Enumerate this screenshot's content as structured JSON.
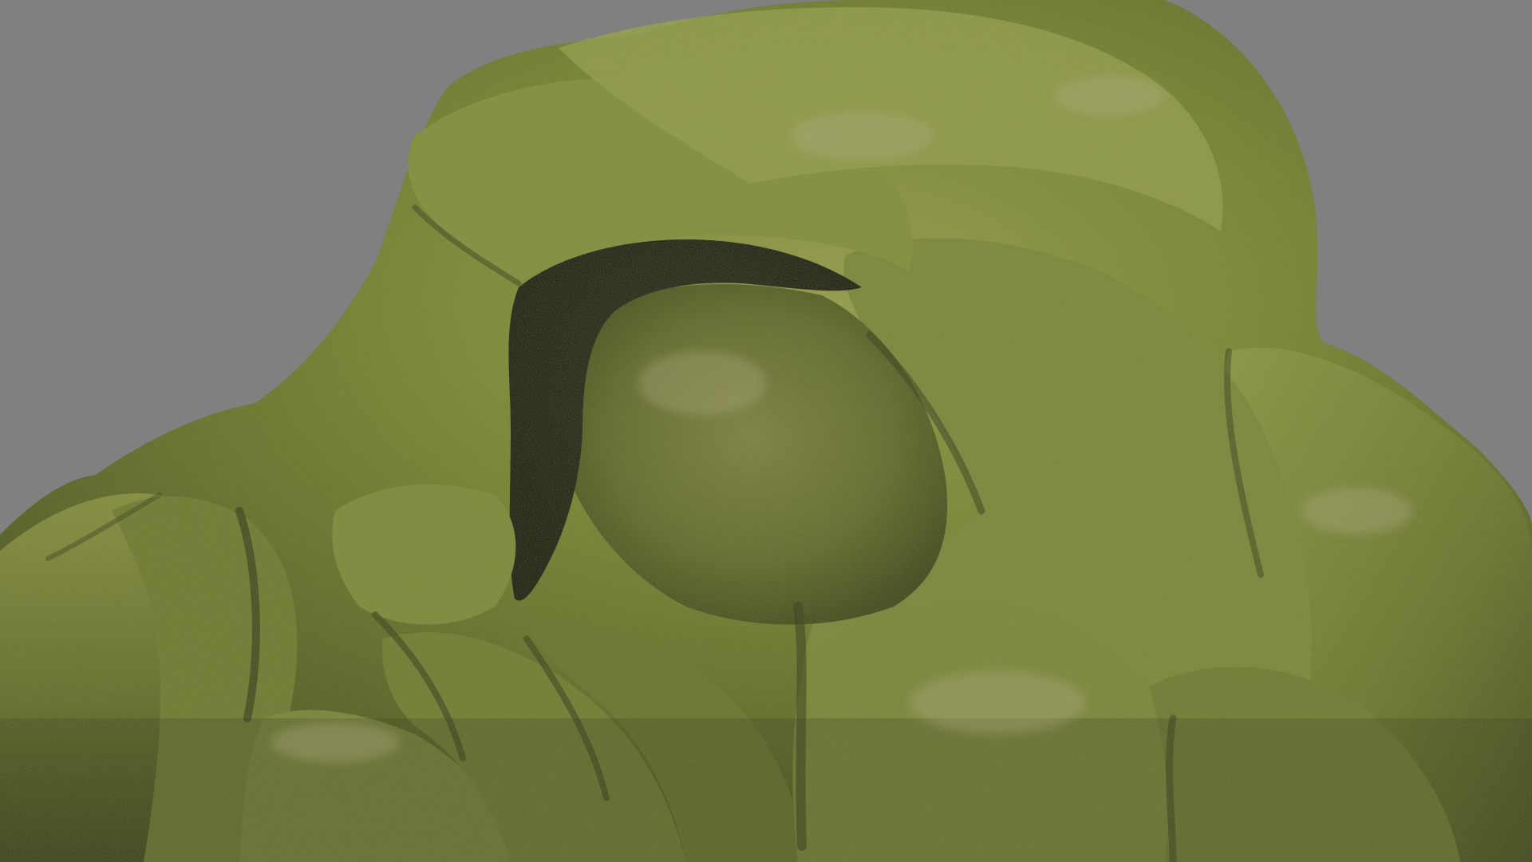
{
  "viewport": {
    "background_color": "#808080"
  },
  "rock": {
    "moss_color": "#6f7f2c",
    "moss_highlight_color": "#9aa948",
    "stone_color": "#8f8a6a",
    "shadow_color": "#2e3018",
    "cave_color": "#141612"
  }
}
